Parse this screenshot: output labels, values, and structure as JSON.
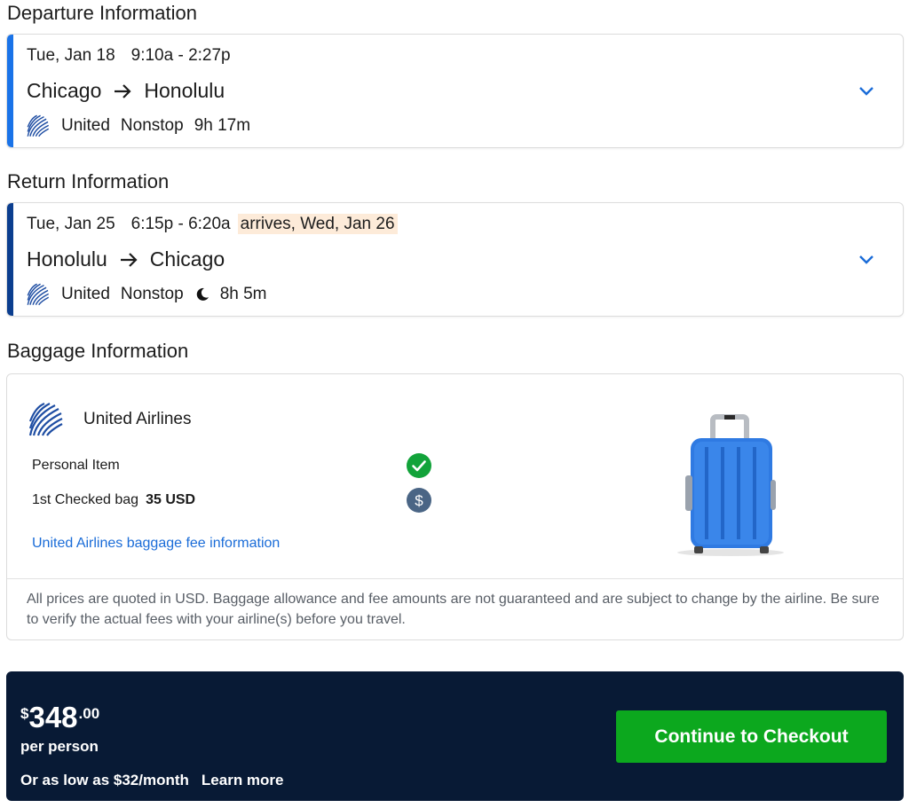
{
  "departure": {
    "section_title": "Departure Information",
    "date": "Tue, Jan 18",
    "time": "9:10a - 2:27p",
    "origin": "Chicago",
    "destination": "Honolulu",
    "airline": "United",
    "stops": "Nonstop",
    "duration": "9h 17m",
    "accent_color": "#1a73e8"
  },
  "return": {
    "section_title": "Return Information",
    "date": "Tue, Jan 25",
    "time": "6:15p - 6:20a",
    "arrival_note": "arrives, Wed, Jan 26",
    "origin": "Honolulu",
    "destination": "Chicago",
    "airline": "United",
    "stops": "Nonstop",
    "overnight_icon": "moon-icon",
    "duration": "8h 5m",
    "accent_color": "#0b3e8f"
  },
  "baggage": {
    "section_title": "Baggage Information",
    "airline_name": "United Airlines",
    "personal_item_label": "Personal Item",
    "personal_item_status": "included",
    "checked_bag_label": "1st Checked bag",
    "checked_bag_fee": "35 USD",
    "fee_link": "United Airlines baggage fee information",
    "disclaimer": "All prices are quoted in USD. Baggage allowance and fee amounts are not guaranteed and are subject to change by the airline. Be sure to verify the actual fees with your airline(s) before you travel."
  },
  "checkout": {
    "currency_symbol": "$",
    "price_whole": "348",
    "price_cents": ".00",
    "per_person": "per person",
    "monthly": "Or as low as $32/month",
    "learn_more": "Learn more",
    "button_label": "Continue to Checkout",
    "button_color": "#0ca81e",
    "bar_color": "#081a35"
  },
  "colors": {
    "link": "#1a6cd8",
    "check_green": "#12a33a",
    "fee_badge": "#4a6585",
    "arrival_highlight": "#fdebd9"
  }
}
